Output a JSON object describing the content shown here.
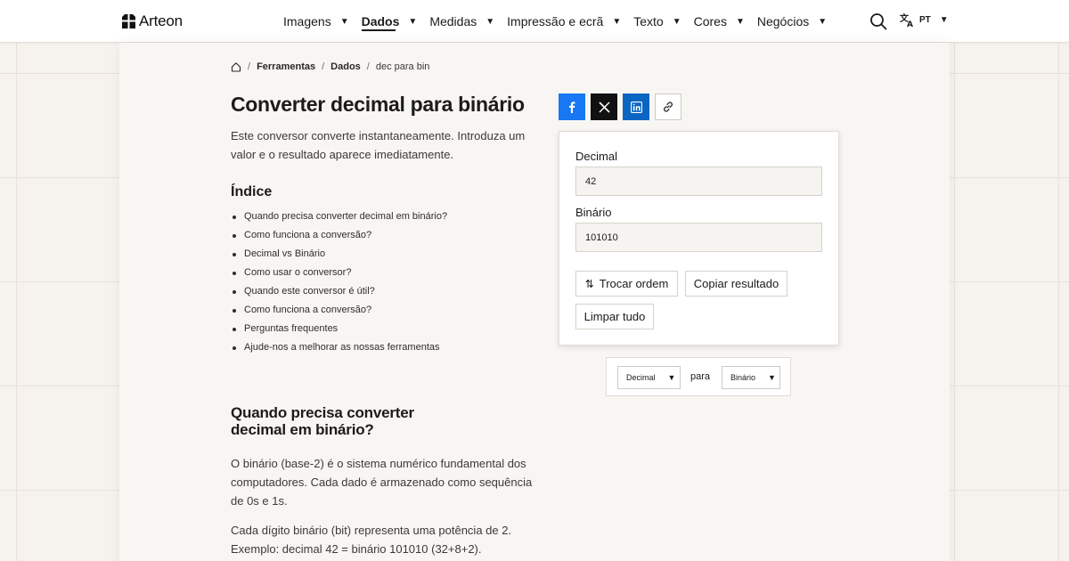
{
  "header": {
    "brand": "Arteon",
    "nav": [
      {
        "label": "Imagens",
        "active": false
      },
      {
        "label": "Dados",
        "active": true
      },
      {
        "label": "Medidas",
        "active": false
      },
      {
        "label": "Impressão e ecrã",
        "active": false
      },
      {
        "label": "Texto",
        "active": false
      },
      {
        "label": "Cores",
        "active": false
      },
      {
        "label": "Negócios",
        "active": false
      }
    ],
    "search_icon": "search-icon",
    "language": {
      "icon": "translate-icon",
      "code": "PT"
    }
  },
  "breadcrumb": {
    "home_icon": "home-icon",
    "items": [
      "Ferramentas",
      "Dados"
    ],
    "current": "dec para bin"
  },
  "page": {
    "title": "Converter decimal para binário",
    "intro": "Este conversor converte instantaneamente. Introduza um valor e o resultado aparece imediatamente."
  },
  "toc": {
    "title": "Índice",
    "items": [
      "Quando precisa converter decimal em binário?",
      "Como funciona a conversão?",
      "Decimal vs Binário",
      "Como usar o conversor?",
      "Quando este conversor é útil?",
      "Como funciona a conversão?",
      "Perguntas frequentes",
      "Ajude-nos a melhorar as nossas ferramentas"
    ]
  },
  "section": {
    "title": "Quando precisa converter decimal em binário?",
    "paragraphs": [
      "O binário (base-2) é o sistema numérico fundamental dos computadores. Cada dado é armazenado como sequência de 0s e 1s.",
      "Cada dígito binário (bit) representa uma potência de 2. Exemplo: decimal 42 = binário 101010 (32+8+2)."
    ]
  },
  "share": {
    "buttons": [
      {
        "name": "facebook",
        "icon": "facebook-icon",
        "color": "#1877f2"
      },
      {
        "name": "x",
        "icon": "x-icon",
        "color": "#111111"
      },
      {
        "name": "linkedin",
        "icon": "linkedin-icon",
        "color": "#0a66c2"
      },
      {
        "name": "copy-link",
        "icon": "link-icon",
        "color": "#ffffff"
      }
    ]
  },
  "converter": {
    "decimal_label": "Decimal",
    "decimal_value": "42",
    "binary_label": "Binário",
    "binary_value": "101010",
    "swap_label": "Trocar ordem",
    "swap_icon": "swap-vertical-icon",
    "copy_label": "Copiar resultado",
    "clear_label": "Limpar tudo"
  },
  "direction": {
    "from": "Decimal",
    "connector": "para",
    "to": "Binário"
  },
  "colors": {
    "background": "#f6f3ef",
    "panel": "#f8f6f3",
    "text": "#1c1b1a",
    "facebook": "#1877f2",
    "linkedin": "#0a66c2"
  }
}
